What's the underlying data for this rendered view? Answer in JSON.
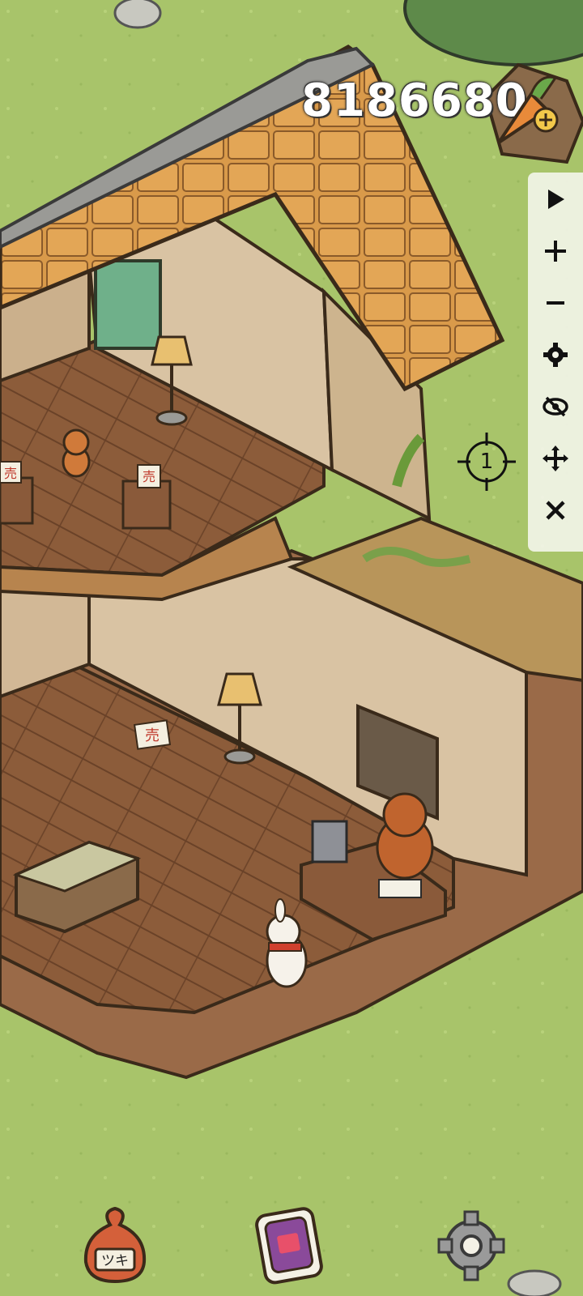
{
  "hud": {
    "carrot_count": "8186680",
    "carrot_icon": "carrot-plus-icon"
  },
  "toolbar": {
    "items": [
      {
        "name": "play-icon"
      },
      {
        "name": "zoom-in-icon"
      },
      {
        "name": "zoom-out-icon"
      },
      {
        "name": "settings-icon"
      },
      {
        "name": "hide-icon"
      },
      {
        "name": "move-icon"
      },
      {
        "name": "close-icon"
      }
    ]
  },
  "reticle": {
    "label": "1"
  },
  "bottom_bar": {
    "bag": {
      "icon": "seed-bag-icon",
      "label": "ツキ"
    },
    "phone": {
      "icon": "phone-icon"
    },
    "settings": {
      "icon": "gear-icon"
    }
  },
  "signs": [
    "売",
    "売",
    "売"
  ],
  "colors": {
    "grass": "#a8c46a",
    "roof": "#d99a4a",
    "wood_floor": "#8a5a3a",
    "wall": "#d9c3a3",
    "curtain": "#6fb08a"
  }
}
